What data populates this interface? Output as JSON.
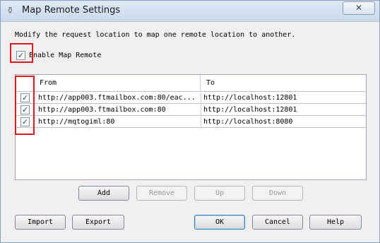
{
  "window": {
    "title": "Map Remote Settings",
    "close_label": "✕"
  },
  "description": "Modify the request location to map one remote location to another.",
  "enable": {
    "label": "Enable Map Remote",
    "checked": true
  },
  "table": {
    "columns": [
      "From",
      "To"
    ],
    "rows": [
      {
        "enabled": true,
        "from": "http://app003.ftmailbox.com:80/eac...",
        "to": "http://localhost:12801"
      },
      {
        "enabled": true,
        "from": "http://app003.ftmailbox.com:80",
        "to": "http://localhost:12801"
      },
      {
        "enabled": true,
        "from": "http://mqtogiml:80",
        "to": "http://localhost:8080"
      }
    ]
  },
  "row_buttons": {
    "add": "Add",
    "remove": "Remove",
    "up": "Up",
    "down": "Down"
  },
  "footer_buttons": {
    "import": "Import",
    "export": "Export",
    "ok": "OK",
    "cancel": "Cancel",
    "help": "Help"
  },
  "check_glyph": "✓"
}
